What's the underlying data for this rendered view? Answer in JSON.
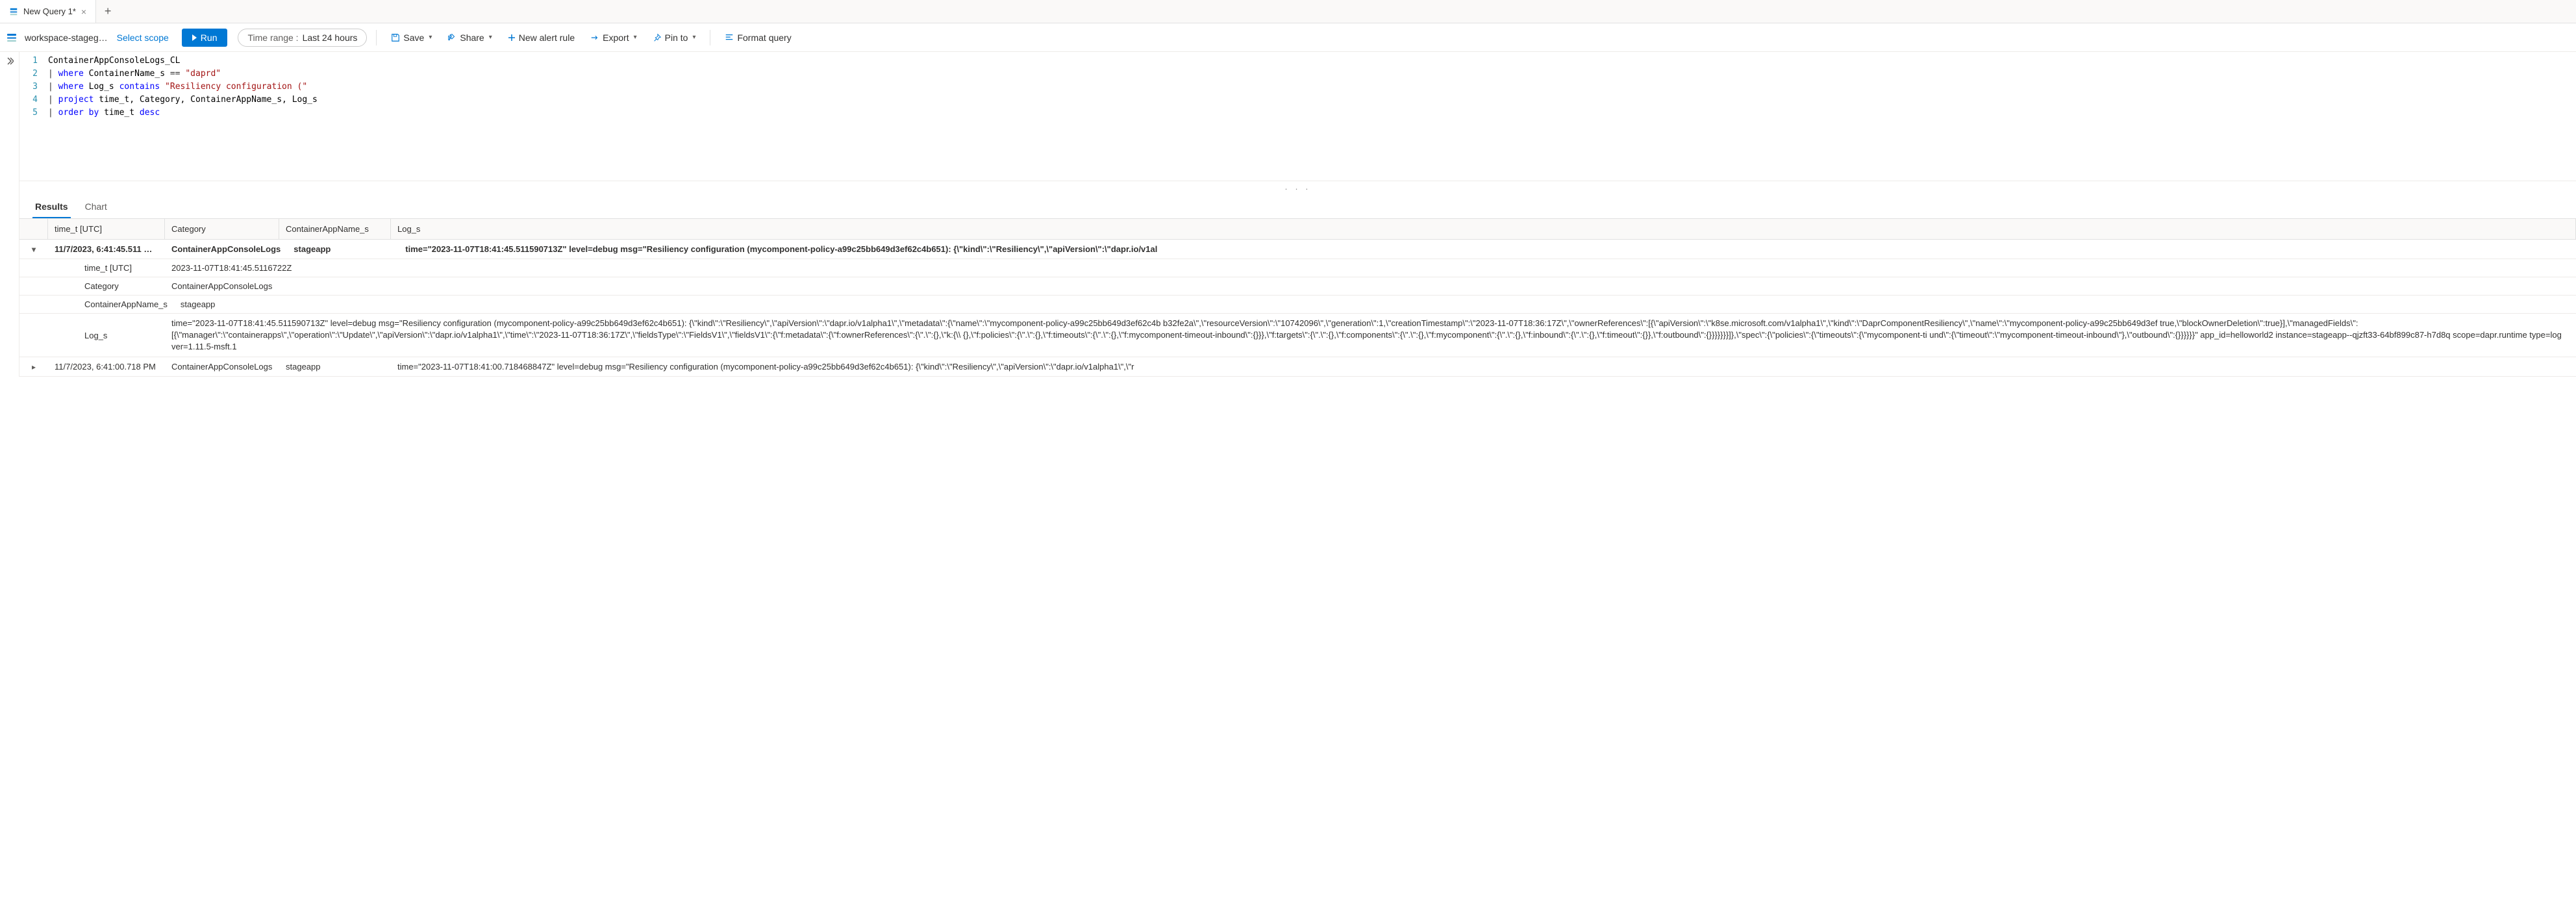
{
  "tab": {
    "title": "New Query 1*"
  },
  "toolbar": {
    "workspace": "workspace-stageg…",
    "select_scope": "Select scope",
    "run": "Run",
    "time_range_label": "Time range :",
    "time_range_value": "Last 24 hours",
    "save": "Save",
    "share": "Share",
    "new_alert": "New alert rule",
    "export": "Export",
    "pin_to": "Pin to",
    "format": "Format query"
  },
  "editor": {
    "lines": [
      {
        "n": "1",
        "raw": "ContainerAppConsoleLogs_CL"
      },
      {
        "n": "2",
        "raw": "| where ContainerName_s == \"daprd\""
      },
      {
        "n": "3",
        "raw": "| where Log_s contains \"Resiliency configuration (\""
      },
      {
        "n": "4",
        "raw": "| project time_t, Category, ContainerAppName_s, Log_s"
      },
      {
        "n": "5",
        "raw": "| order by time_t desc"
      }
    ]
  },
  "results": {
    "tabs": {
      "results": "Results",
      "chart": "Chart"
    },
    "columns": {
      "time": "time_t [UTC]",
      "category": "Category",
      "app": "ContainerAppName_s",
      "log": "Log_s"
    },
    "rows": [
      {
        "expanded": true,
        "time": "11/7/2023, 6:41:45.511 …",
        "category": "ContainerAppConsoleLogs",
        "app": "stageapp",
        "log_preview": "time=\"2023-11-07T18:41:45.511590713Z\" level=debug msg=\"Resiliency configuration (mycomponent-policy-a99c25bb649d3ef62c4b651): {\\\"kind\\\":\\\"Resiliency\\\",\\\"apiVersion\\\":\\\"dapr.io/v1al",
        "details": {
          "time_t": "2023-11-07T18:41:45.5116722Z",
          "category": "ContainerAppConsoleLogs",
          "app": "stageapp",
          "log": "time=\"2023-11-07T18:41:45.511590713Z\" level=debug msg=\"Resiliency configuration (mycomponent-policy-a99c25bb649d3ef62c4b651): {\\\"kind\\\":\\\"Resiliency\\\",\\\"apiVersion\\\":\\\"dapr.io/v1alpha1\\\",\\\"metadata\\\":{\\\"name\\\":\\\"mycomponent-policy-a99c25bb649d3ef62c4b b32fe2a\\\",\\\"resourceVersion\\\":\\\"10742096\\\",\\\"generation\\\":1,\\\"creationTimestamp\\\":\\\"2023-11-07T18:36:17Z\\\",\\\"ownerReferences\\\":[{\\\"apiVersion\\\":\\\"k8se.microsoft.com/v1alpha1\\\",\\\"kind\\\":\\\"DaprComponentResiliency\\\",\\\"name\\\":\\\"mycomponent-policy-a99c25bb649d3ef true,\\\"blockOwnerDeletion\\\":true}],\\\"managedFields\\\":[{\\\"manager\\\":\\\"containerapps\\\",\\\"operation\\\":\\\"Update\\\",\\\"apiVersion\\\":\\\"dapr.io/v1alpha1\\\",\\\"time\\\":\\\"2023-11-07T18:36:17Z\\\",\\\"fieldsType\\\":\\\"FieldsV1\\\",\\\"fieldsV1\\\":{\\\"f:metadata\\\":{\\\"f:ownerReferences\\\":{\\\".\\\":{},\\\"k:{\\\\ {},\\\"f:policies\\\":{\\\".\\\":{},\\\"f:timeouts\\\":{\\\".\\\":{},\\\"f:mycomponent-timeout-inbound\\\":{}}},\\\"f:targets\\\":{\\\".\\\":{},\\\"f:components\\\":{\\\".\\\":{},\\\"f:mycomponent\\\":{\\\".\\\":{},\\\"f:inbound\\\":{\\\".\\\":{},\\\"f:timeout\\\":{}},\\\"f:outbound\\\":{}}}}}}}]},\\\"spec\\\":{\\\"policies\\\":{\\\"timeouts\\\":{\\\"mycomponent-ti und\\\":{\\\"timeout\\\":\\\"mycomponent-timeout-inbound\\\"},\\\"outbound\\\":{}}}}}}\" app_id=helloworld2 instance=stageapp--qjzft33-64bf899c87-h7d8q scope=dapr.runtime type=log ver=1.11.5-msft.1"
        }
      },
      {
        "expanded": false,
        "time": "11/7/2023, 6:41:00.718 PM",
        "category": "ContainerAppConsoleLogs",
        "app": "stageapp",
        "log_preview": "time=\"2023-11-07T18:41:00.718468847Z\" level=debug msg=\"Resiliency configuration (mycomponent-policy-a99c25bb649d3ef62c4b651): {\\\"kind\\\":\\\"Resiliency\\\",\\\"apiVersion\\\":\\\"dapr.io/v1alpha1\\\",\\\"r"
      }
    ]
  },
  "detail_labels": {
    "time_t": "time_t [UTC]",
    "category": "Category",
    "app": "ContainerAppName_s",
    "log": "Log_s"
  }
}
